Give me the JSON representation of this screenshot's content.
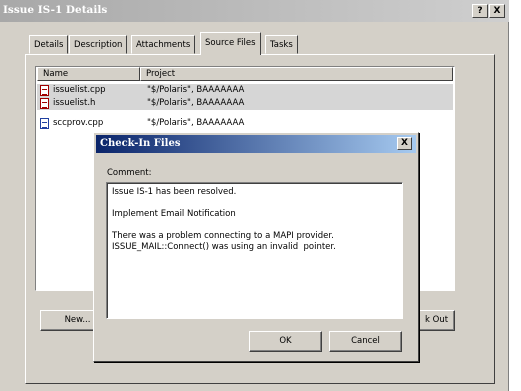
{
  "window": {
    "title": "Issue IS-1 Details",
    "help_button": "?",
    "close_button": "X"
  },
  "tabs": [
    {
      "label": "Details"
    },
    {
      "label": "Description"
    },
    {
      "label": "Attachments"
    },
    {
      "label": "Source Files",
      "active": true
    },
    {
      "label": "Tasks"
    }
  ],
  "file_list": {
    "columns": [
      "Name",
      "Project"
    ],
    "rows": [
      {
        "name": "issuelist.cpp",
        "project": "\"$/Polaris\", BAAAAAAA",
        "selected": true,
        "icon": "modified-file-icon"
      },
      {
        "name": "issuelist.h",
        "project": "\"$/Polaris\", BAAAAAAA",
        "selected": true,
        "icon": "modified-file-icon"
      },
      {
        "name": "sccprov.cpp",
        "project": "\"$/Polaris\", BAAAAAAA",
        "selected": false,
        "icon": "file-icon"
      }
    ]
  },
  "buttons": {
    "new_label": "New...",
    "checkout_label": "k Out"
  },
  "dialog": {
    "title": "Check-In Files",
    "close": "X",
    "comment_label": "Comment:",
    "comment_text": "Issue IS-1 has been resolved.\n\nImplement Email Notification\n\nThere was a problem connecting to a MAPI provider.\nISSUE_MAIL::Connect() was using an invalid  pointer.",
    "ok_label": "OK",
    "cancel_label": "Cancel"
  }
}
